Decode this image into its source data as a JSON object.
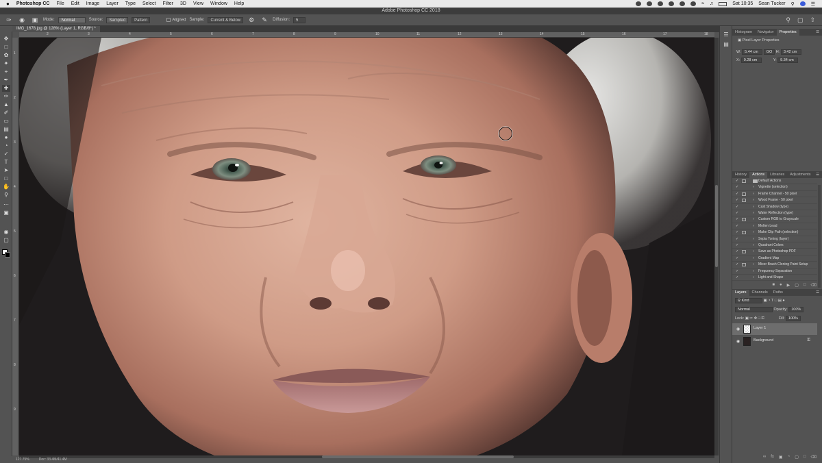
{
  "menubar": {
    "apple": "",
    "app_name": "Photoshop CC",
    "items": [
      "File",
      "Edit",
      "Image",
      "Layer",
      "Type",
      "Select",
      "Filter",
      "3D",
      "View",
      "Window",
      "Help"
    ],
    "clock": "Sat 10:35",
    "user": "Sean Tucker"
  },
  "window_title": "Adobe Photoshop CC 2018",
  "options": {
    "mode_label": "Mode:",
    "mode_value": "Normal",
    "source_label": "Source:",
    "source_sampled": "Sampled",
    "source_pattern": "Pattern",
    "aligned_label": "Aligned",
    "sample_label": "Sample:",
    "sample_value": "Current & Below",
    "diffusion_label": "Diffusion:",
    "diffusion_value": "5"
  },
  "document": {
    "tab": "IMG_1678.jpg @ 128% (Layer 1, RGB/8*) *",
    "zoom": "127.75%",
    "doc_size": "Doc: 33.4M/41.4M",
    "ruler_top": [
      "2",
      "3",
      "4",
      "5",
      "6",
      "7",
      "8",
      "9",
      "10",
      "11",
      "12",
      "13",
      "14",
      "15",
      "16",
      "17",
      "18",
      "19"
    ],
    "ruler_left": [
      "1",
      "2",
      "3",
      "4",
      "5",
      "6",
      "7",
      "8",
      "9"
    ]
  },
  "panels": {
    "top_tabs": [
      "Histogram",
      "Navigator",
      "Properties"
    ],
    "properties": {
      "title": "Pixel Layer Properties",
      "w_label": "W:",
      "w_value": "5.44 cm",
      "h_label": "H:",
      "h_value": "3.42 cm",
      "x_label": "X:",
      "x_value": "9.28 cm",
      "y_label": "Y:",
      "y_value": "9.34 cm",
      "link_label": "GO"
    },
    "mid_tabs": [
      "History",
      "Actions",
      "Libraries",
      "Adjustments"
    ],
    "actions": [
      {
        "name": "Default Actions",
        "folder": true
      },
      {
        "name": "Vignette (selection)"
      },
      {
        "name": "Frame Channel - 50 pixel"
      },
      {
        "name": "Wood Frame - 50 pixel"
      },
      {
        "name": "Cast Shadow (type)"
      },
      {
        "name": "Water Reflection (type)"
      },
      {
        "name": "Custom RGB to Grayscale"
      },
      {
        "name": "Molten Lead"
      },
      {
        "name": "Make Clip Path (selection)"
      },
      {
        "name": "Sepia Toning (layer)"
      },
      {
        "name": "Quadrant Colors"
      },
      {
        "name": "Save as Photoshop PDF"
      },
      {
        "name": "Gradient Map"
      },
      {
        "name": "Mixer Brush Cloning Paint Setup"
      },
      {
        "name": "Frequency Separation"
      },
      {
        "name": "Light and Shape"
      }
    ],
    "layer_tabs": [
      "Layers",
      "Channels",
      "Paths"
    ],
    "layers": {
      "kind": "Kind",
      "blend": "Normal",
      "opacity_label": "Opacity:",
      "opacity_value": "100%",
      "lock_label": "Lock:",
      "fill_label": "Fill:",
      "fill_value": "100%",
      "items": [
        {
          "name": "Layer 1",
          "selected": true
        },
        {
          "name": "Background",
          "locked": true
        }
      ]
    }
  }
}
